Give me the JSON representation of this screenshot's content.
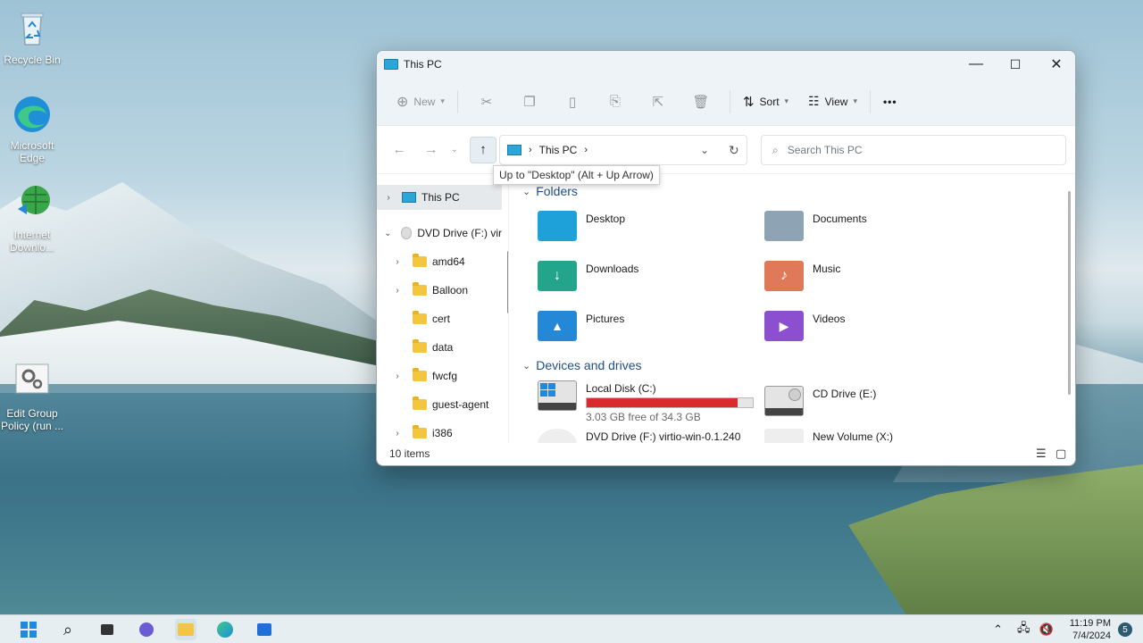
{
  "desktop": {
    "icons": [
      {
        "label": "Recycle Bin"
      },
      {
        "label": "Microsoft Edge"
      },
      {
        "label": "Internet Downlo..."
      },
      {
        "label": "Edit Group Policy (run ..."
      }
    ]
  },
  "window": {
    "title": "This PC",
    "controls": {
      "minimize": "—",
      "maximize": "☐",
      "close": "✕"
    },
    "toolbar": {
      "new_label": "New",
      "sort_label": "Sort",
      "view_label": "View",
      "more_label": "•••"
    },
    "address": {
      "crumb": "This PC"
    },
    "search": {
      "placeholder": "Search This PC"
    },
    "tooltip": "Up to \"Desktop\" (Alt + Up Arrow)",
    "nav_pane": {
      "items": [
        {
          "label": "This PC"
        },
        {
          "label": "DVD Drive (F:) vir"
        },
        {
          "label": "amd64"
        },
        {
          "label": "Balloon"
        },
        {
          "label": "cert"
        },
        {
          "label": "data"
        },
        {
          "label": "fwcfg"
        },
        {
          "label": "guest-agent"
        },
        {
          "label": "i386"
        }
      ]
    },
    "content": {
      "folders_header": "Folders",
      "folders": [
        {
          "label": "Desktop",
          "color": "#1ea1d9"
        },
        {
          "label": "Documents",
          "color": "#8ea3b3"
        },
        {
          "label": "Downloads",
          "color": "#22a58b"
        },
        {
          "label": "Music",
          "color": "#e0785a"
        },
        {
          "label": "Pictures",
          "color": "#2488d6"
        },
        {
          "label": "Videos",
          "color": "#8b4fd0"
        }
      ],
      "devices_header": "Devices and drives",
      "drives": [
        {
          "label": "Local Disk (C:)",
          "free_text": "3.03 GB free of 34.3 GB",
          "used_fraction": 0.91,
          "bar_color": "#d92b2b"
        },
        {
          "label": "CD Drive (E:)"
        },
        {
          "label": "DVD Drive (F:) virtio-win-0.1.240"
        },
        {
          "label": "New Volume (X:)"
        }
      ]
    },
    "status": {
      "items_text": "10 items"
    }
  },
  "taskbar": {
    "time": "11:19 PM",
    "date": "7/4/2024",
    "notification_count": "5"
  }
}
